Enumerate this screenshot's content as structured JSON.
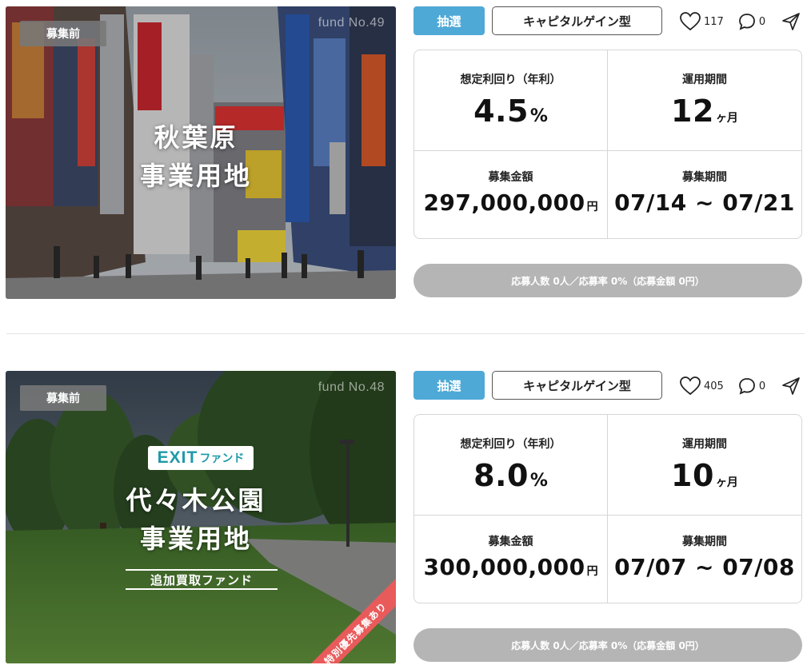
{
  "funds": [
    {
      "status": "募集前",
      "fund_no": "fund No.49",
      "title_lines": [
        "秋葉原",
        "事業用地"
      ],
      "lottery_label": "抽選",
      "type_label": "キャピタルゲイン型",
      "likes": "117",
      "comments": "0",
      "yield_label": "想定利回り（年利）",
      "yield_value": "4.5",
      "yield_unit": "%",
      "term_label": "運用期間",
      "term_value": "12",
      "term_unit": "ヶ月",
      "amount_label": "募集金額",
      "amount_value": "297,000,000",
      "amount_unit": "円",
      "period_label": "募集期間",
      "period_value": "07/14 ~ 07/21",
      "progress_text": "応募人数 0人／応募率 0%（応募金額 0円）",
      "progress_fraction": 0
    },
    {
      "status": "募集前",
      "fund_no": "fund No.48",
      "exit_logo": "EXIT",
      "exit_suffix": "ファンド",
      "title_lines": [
        "代々木公園",
        "事業用地"
      ],
      "subtitle": "追加買取ファンド",
      "ribbon": "特別優先募集あり",
      "lottery_label": "抽選",
      "type_label": "キャピタルゲイン型",
      "likes": "405",
      "comments": "0",
      "yield_label": "想定利回り（年利）",
      "yield_value": "8.0",
      "yield_unit": "%",
      "term_label": "運用期間",
      "term_value": "10",
      "term_unit": "ヶ月",
      "amount_label": "募集金額",
      "amount_value": "300,000,000",
      "amount_unit": "円",
      "period_label": "募集期間",
      "period_value": "07/07 ~ 07/08",
      "progress_text": "応募人数 0人／応募率 0%（応募金額 0円）",
      "progress_fraction": 0
    }
  ],
  "colors": {
    "accent": "#4ea9d6",
    "status_tag": "#787878",
    "progress_bg": "#b5b5b5",
    "ribbon": "#e95a5a",
    "exit_teal": "#1e9aa8"
  },
  "icons": {
    "like": "heart-icon",
    "comment": "speech-bubble-icon",
    "share": "paper-plane-icon"
  }
}
